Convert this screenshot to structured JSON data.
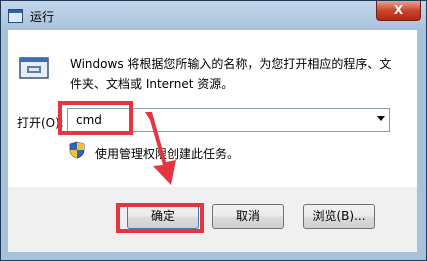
{
  "window": {
    "title": "运行",
    "close_glyph": "X"
  },
  "dialog": {
    "description": "Windows 将根据您所输入的名称，为您打开相应的程序、文件夹、文档或 Internet 资源。",
    "open_label": "打开(O):",
    "command_value": "cmd",
    "admin_note": "使用管理权限创建此任务。"
  },
  "buttons": {
    "ok": "确定",
    "cancel": "取消",
    "browse": "浏览(B)..."
  },
  "annotations": {
    "highlight_color": "#e8343f"
  },
  "icons": [
    "run-program-icon",
    "uac-shield-icon",
    "dropdown-arrow-icon"
  ]
}
